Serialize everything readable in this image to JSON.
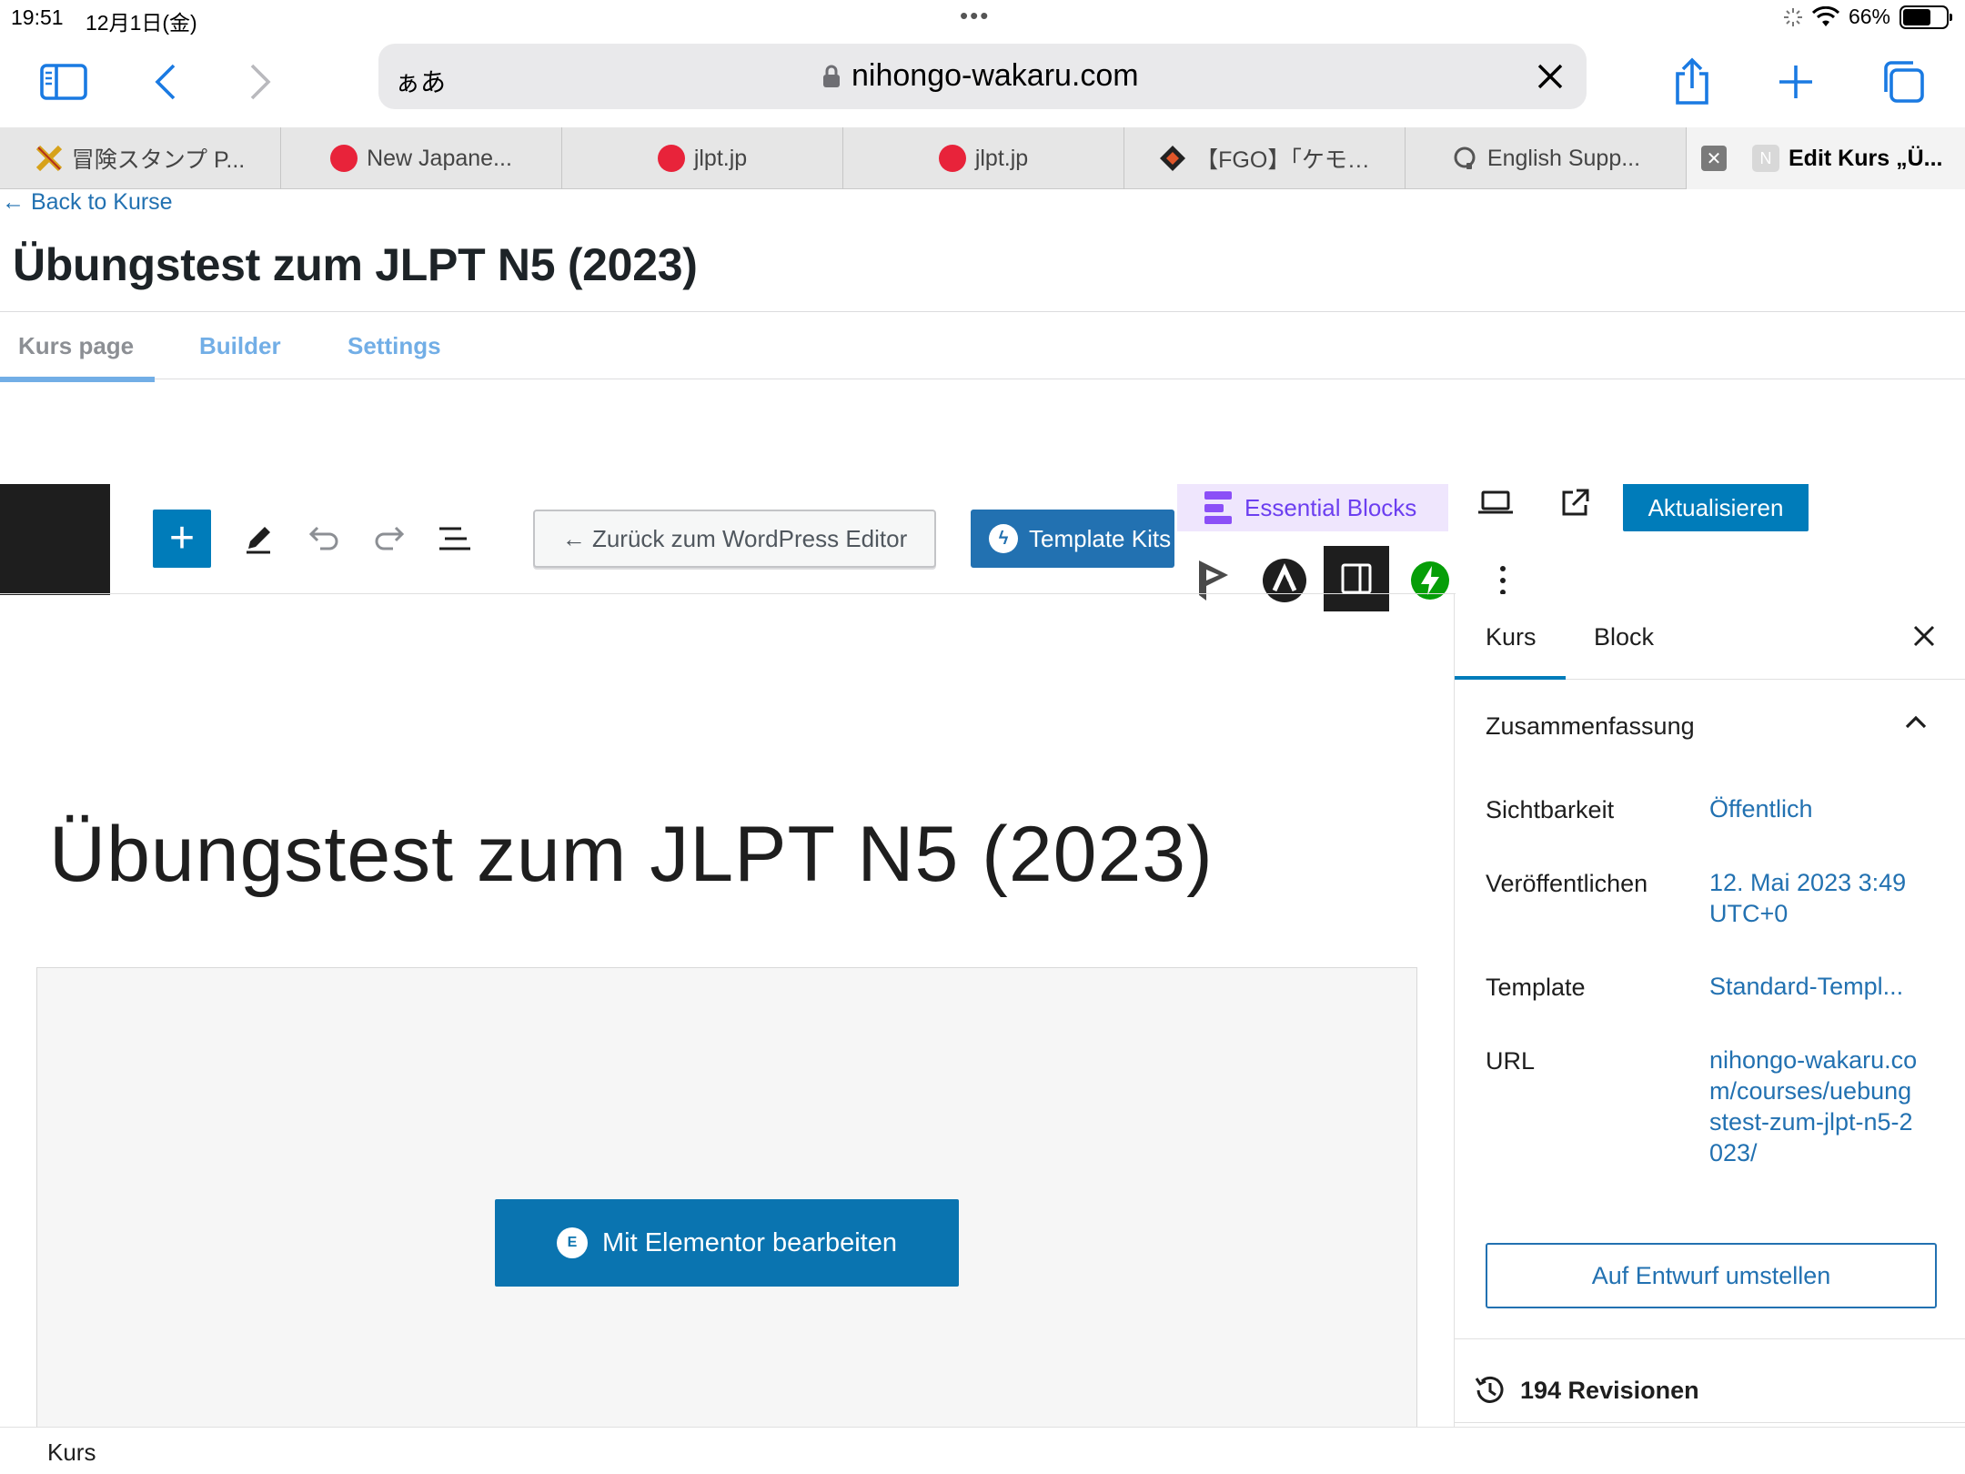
{
  "status_bar": {
    "time": "19:51",
    "date": "12月1日(金)",
    "battery": "66%",
    "battery_level": 0.66
  },
  "browser": {
    "address_prefix": "ぁあ",
    "url": "nihongo-wakaru.com",
    "tabs": [
      {
        "label": "冒険スタンプ P...",
        "icon": "x-logo-icon"
      },
      {
        "label": "New Japane...",
        "icon": "red-circle-icon"
      },
      {
        "label": "jlpt.jp",
        "icon": "red-circle-icon"
      },
      {
        "label": "jlpt.jp",
        "icon": "red-circle-icon"
      },
      {
        "label": "【FGO】｢ケモ…",
        "icon": "diamond-logo-icon"
      },
      {
        "label": "English Supp...",
        "icon": "support-icon"
      },
      {
        "label": "Edit Kurs „Ü...",
        "icon": "n-icon",
        "active": true
      }
    ]
  },
  "page": {
    "back_link": "← Back to Kurse",
    "title": "Übungstest zum JLPT N5 (2023)",
    "subnav": [
      "Kurs page",
      "Builder",
      "Settings"
    ]
  },
  "editor_toolbar": {
    "back_to_wp": "← Zurück zum WordPress Editor",
    "template_kits": "Template Kits",
    "essential_blocks": "Essential Blocks",
    "update": "Aktualisieren"
  },
  "canvas": {
    "post_title": "Übungstest zum JLPT N5 (2023)",
    "elementor_button": "Mit Elementor bearbeiten",
    "breadcrumb": "Kurs"
  },
  "sidebar": {
    "tabs": [
      "Kurs",
      "Block"
    ],
    "panel_title": "Zusammenfassung",
    "rows": [
      {
        "label": "Sichtbarkeit",
        "value": "Öffentlich"
      },
      {
        "label": "Veröffentlichen",
        "value": "12. Mai 2023 3:49 UTC+0"
      },
      {
        "label": "Template",
        "value": "Standard-Templ..."
      },
      {
        "label": "URL",
        "value": "nihongo-wakaru.com/courses/uebungstest-zum-jlpt-n5-2023/"
      }
    ],
    "draft_button": "Auf Entwurf umstellen",
    "revisions": "194 Revisionen"
  },
  "colors": {
    "wp_blue": "#007cba",
    "link_blue": "#2271b1",
    "ios_blue": "#1a7ae2",
    "essential_purple": "#6c3ff0"
  }
}
